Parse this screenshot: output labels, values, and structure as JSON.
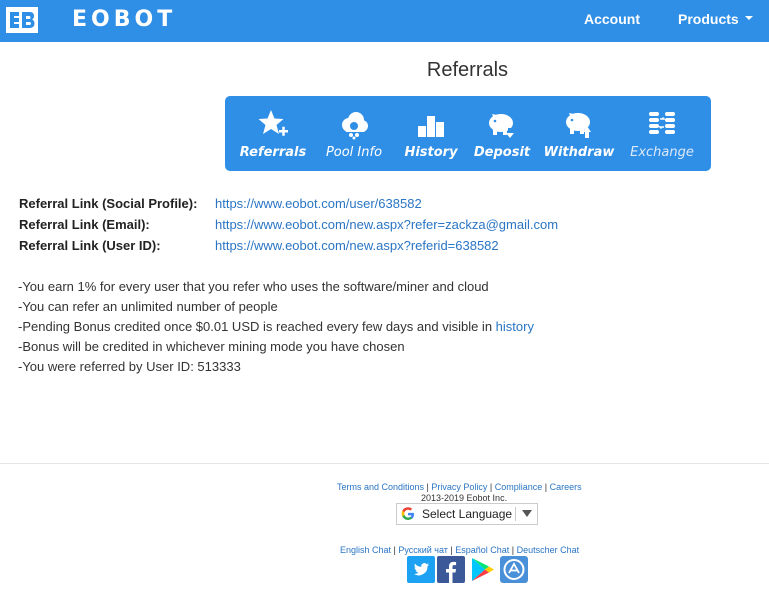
{
  "header": {
    "logo_text": "EOBOT",
    "nav": {
      "account": "Account",
      "products": "Products"
    }
  },
  "page": {
    "title": "Referrals"
  },
  "toolbar": {
    "items": [
      {
        "label": "Referrals",
        "icon": "star-plus-icon"
      },
      {
        "label": "Pool Info",
        "icon": "cloud-icon"
      },
      {
        "label": "History",
        "icon": "bar-chart-icon"
      },
      {
        "label": "Deposit",
        "icon": "piggy-bank-deposit-icon"
      },
      {
        "label": "Withdraw",
        "icon": "piggy-bank-withdraw-icon"
      },
      {
        "label": "Exchange",
        "icon": "coin-stacks-icon"
      }
    ]
  },
  "referral_links": [
    {
      "label": "Referral Link (Social Profile):",
      "url": "https://www.eobot.com/user/638582"
    },
    {
      "label": "Referral Link (Email):",
      "url": "https://www.eobot.com/new.aspx?refer=zackza@gmail.com"
    },
    {
      "label": "Referral Link (User ID):",
      "url": "https://www.eobot.com/new.aspx?referid=638582"
    }
  ],
  "info": {
    "line1": "-You earn 1% for every user that you refer who uses the software/miner and cloud",
    "line2": "-You can refer an unlimited number of people",
    "line3_prefix": "-Pending Bonus credited once $0.01 USD is reached every few days and visible in ",
    "line3_link": "history",
    "line4": "-Bonus will be credited in whichever mining mode you have chosen",
    "line5": "-You were referred by User ID: 513333"
  },
  "footer": {
    "links": {
      "terms": "Terms and Conditions",
      "privacy": "Privacy Policy",
      "compliance": "Compliance",
      "careers": "Careers",
      "separator": " | "
    },
    "copyright": "2013-2019 Eobot Inc.",
    "language_select": "Select Language",
    "chats": {
      "english": "English Chat",
      "russian": "Русский чат",
      "spanish": "Español Chat",
      "german": "Deutscher Chat"
    },
    "social": [
      {
        "name": "twitter-icon",
        "color": "#1da1f2"
      },
      {
        "name": "facebook-icon",
        "color": "#3b5998"
      },
      {
        "name": "google-play-icon",
        "color": "#ffffff"
      },
      {
        "name": "app-store-icon",
        "color": "#4a90d9"
      }
    ]
  },
  "colors": {
    "brand_blue": "#2f8ee6",
    "link_blue": "#2a75c4"
  }
}
